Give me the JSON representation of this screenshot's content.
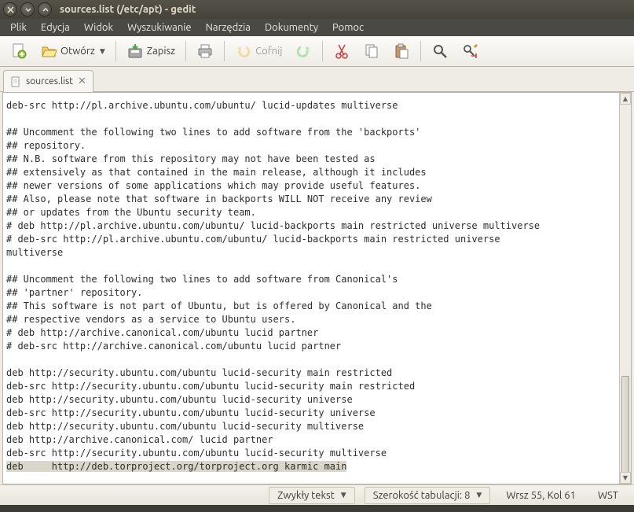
{
  "window": {
    "title": "sources.list (/etc/apt) - gedit"
  },
  "menu": {
    "file": "Plik",
    "edit": "Edycja",
    "view": "Widok",
    "search": "Wyszukiwanie",
    "tools": "Narzędzia",
    "documents": "Dokumenty",
    "help": "Pomoc"
  },
  "toolbar": {
    "open": "Otwórz",
    "save": "Zapisz",
    "undo": "Cofnij"
  },
  "tab": {
    "name": "sources.list"
  },
  "editor": {
    "lines": [
      "deb-src http://pl.archive.ubuntu.com/ubuntu/ lucid-updates multiverse",
      "",
      "## Uncomment the following two lines to add software from the 'backports'",
      "## repository.",
      "## N.B. software from this repository may not have been tested as",
      "## extensively as that contained in the main release, although it includes",
      "## newer versions of some applications which may provide useful features.",
      "## Also, please note that software in backports WILL NOT receive any review",
      "## or updates from the Ubuntu security team.",
      "# deb http://pl.archive.ubuntu.com/ubuntu/ lucid-backports main restricted universe multiverse",
      "# deb-src http://pl.archive.ubuntu.com/ubuntu/ lucid-backports main restricted universe ",
      "multiverse",
      "",
      "## Uncomment the following two lines to add software from Canonical's",
      "## 'partner' repository.",
      "## This software is not part of Ubuntu, but is offered by Canonical and the",
      "## respective vendors as a service to Ubuntu users.",
      "# deb http://archive.canonical.com/ubuntu lucid partner",
      "# deb-src http://archive.canonical.com/ubuntu lucid partner",
      "",
      "deb http://security.ubuntu.com/ubuntu lucid-security main restricted",
      "deb-src http://security.ubuntu.com/ubuntu lucid-security main restricted",
      "deb http://security.ubuntu.com/ubuntu lucid-security universe",
      "deb-src http://security.ubuntu.com/ubuntu lucid-security universe",
      "deb http://security.ubuntu.com/ubuntu lucid-security multiverse",
      "deb http://archive.canonical.com/ lucid partner",
      "deb-src http://security.ubuntu.com/ubuntu lucid-security multiverse"
    ],
    "highlighted_line": "deb     http://deb.torproject.org/torproject.org karmic main"
  },
  "status": {
    "syntax": "Zwykły tekst",
    "tabwidth": "Szerokość tabulacji: 8",
    "position": "Wrsz 55, Kol 61",
    "insert": "WST"
  }
}
